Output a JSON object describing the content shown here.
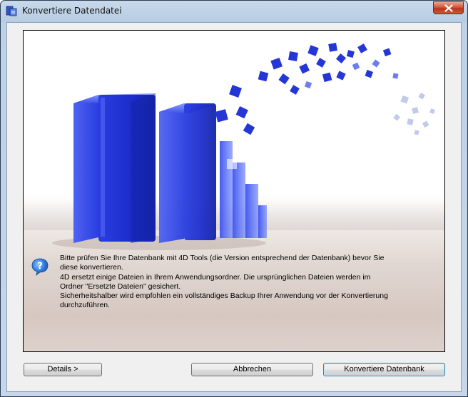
{
  "window": {
    "title": "Konvertiere Datendatei",
    "close_glyph": "×"
  },
  "message": {
    "icon": "help-question-icon",
    "lines": [
      "Bitte prüfen Sie Ihre Datenbank mit 4D Tools (die Version entsprechend der Datenbank) bevor Sie",
      "diese konvertieren.",
      "4D ersetzt einige Dateien in Ihrem Anwendungsordner. Die ursprünglichen Dateien werden im",
      "Ordner \"Ersetzte Dateien\" gesichert.",
      "Sicherheitshalber wird empfohlen ein vollständiges Backup Ihrer Anwendung vor der Konvertierung",
      "durchzuführen."
    ]
  },
  "buttons": {
    "details": "Details >",
    "cancel": "Abbrechen",
    "convert": "Konvertiere Datenbank"
  },
  "colors": {
    "accent_blue": "#1c2fd0",
    "titlebar": "#c9d9ea",
    "close_red": "#c9452a"
  }
}
